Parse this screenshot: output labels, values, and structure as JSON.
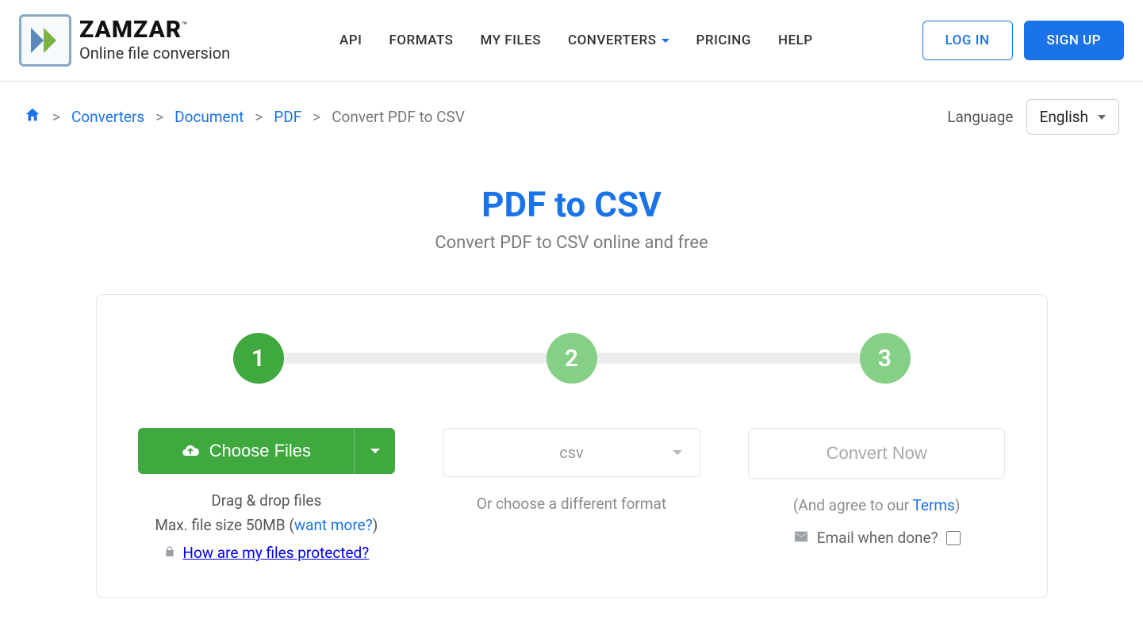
{
  "brand": {
    "title": "ZAMZAR",
    "tm": "™",
    "subtitle": "Online file conversion"
  },
  "nav": {
    "api": "API",
    "formats": "FORMATS",
    "myfiles": "MY FILES",
    "converters": "CONVERTERS",
    "pricing": "PRICING",
    "help": "HELP"
  },
  "auth": {
    "login": "LOG IN",
    "signup": "SIGN UP"
  },
  "breadcrumb": {
    "converters": "Converters",
    "document": "Document",
    "pdf": "PDF",
    "current": "Convert PDF to CSV"
  },
  "language": {
    "label": "Language",
    "value": "English"
  },
  "hero": {
    "title": "PDF to CSV",
    "subtitle": "Convert PDF to CSV online and free"
  },
  "steps": {
    "s1": "1",
    "s2": "2",
    "s3": "3"
  },
  "col1": {
    "choose": "Choose Files",
    "drag": "Drag & drop files",
    "max_prefix": "Max. file size 50MB (",
    "want_more": "want more?",
    "max_suffix": ")",
    "protected": "How are my files protected?"
  },
  "col2": {
    "format": "csv",
    "or": "Or choose a different format"
  },
  "col3": {
    "convert": "Convert Now",
    "agree_prefix": "(And agree to our ",
    "terms": "Terms",
    "agree_suffix": ")",
    "email": "Email when done?"
  }
}
